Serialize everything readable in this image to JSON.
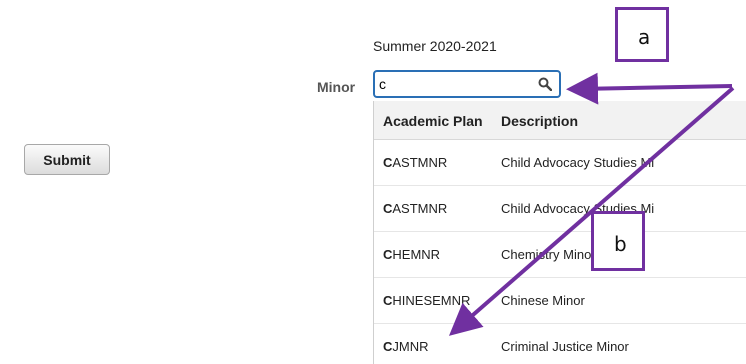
{
  "term": "Summer 2020-2021",
  "minor_label": "Minor",
  "search": {
    "value": "c"
  },
  "submit_label": "Submit",
  "columns": [
    "Academic Plan",
    "Description"
  ],
  "rows": [
    {
      "code_first": "C",
      "code_rest": "ASTMNR",
      "description": "Child Advocacy Studies Mi"
    },
    {
      "code_first": "C",
      "code_rest": "ASTMNR",
      "description": "Child Advocacy Studies Mi"
    },
    {
      "code_first": "C",
      "code_rest": "HEMNR",
      "description": "Chemistry Minor"
    },
    {
      "code_first": "C",
      "code_rest": "HINESEMNR",
      "description": "Chinese Minor"
    },
    {
      "code_first": "C",
      "code_rest": "JMNR",
      "description": "Criminal Justice Minor"
    }
  ],
  "callouts": {
    "a": "a",
    "b": "b"
  },
  "colors": {
    "accent_border": "#2a6fb5",
    "callout": "#7030a0"
  },
  "icons": {
    "search": "search-icon"
  }
}
